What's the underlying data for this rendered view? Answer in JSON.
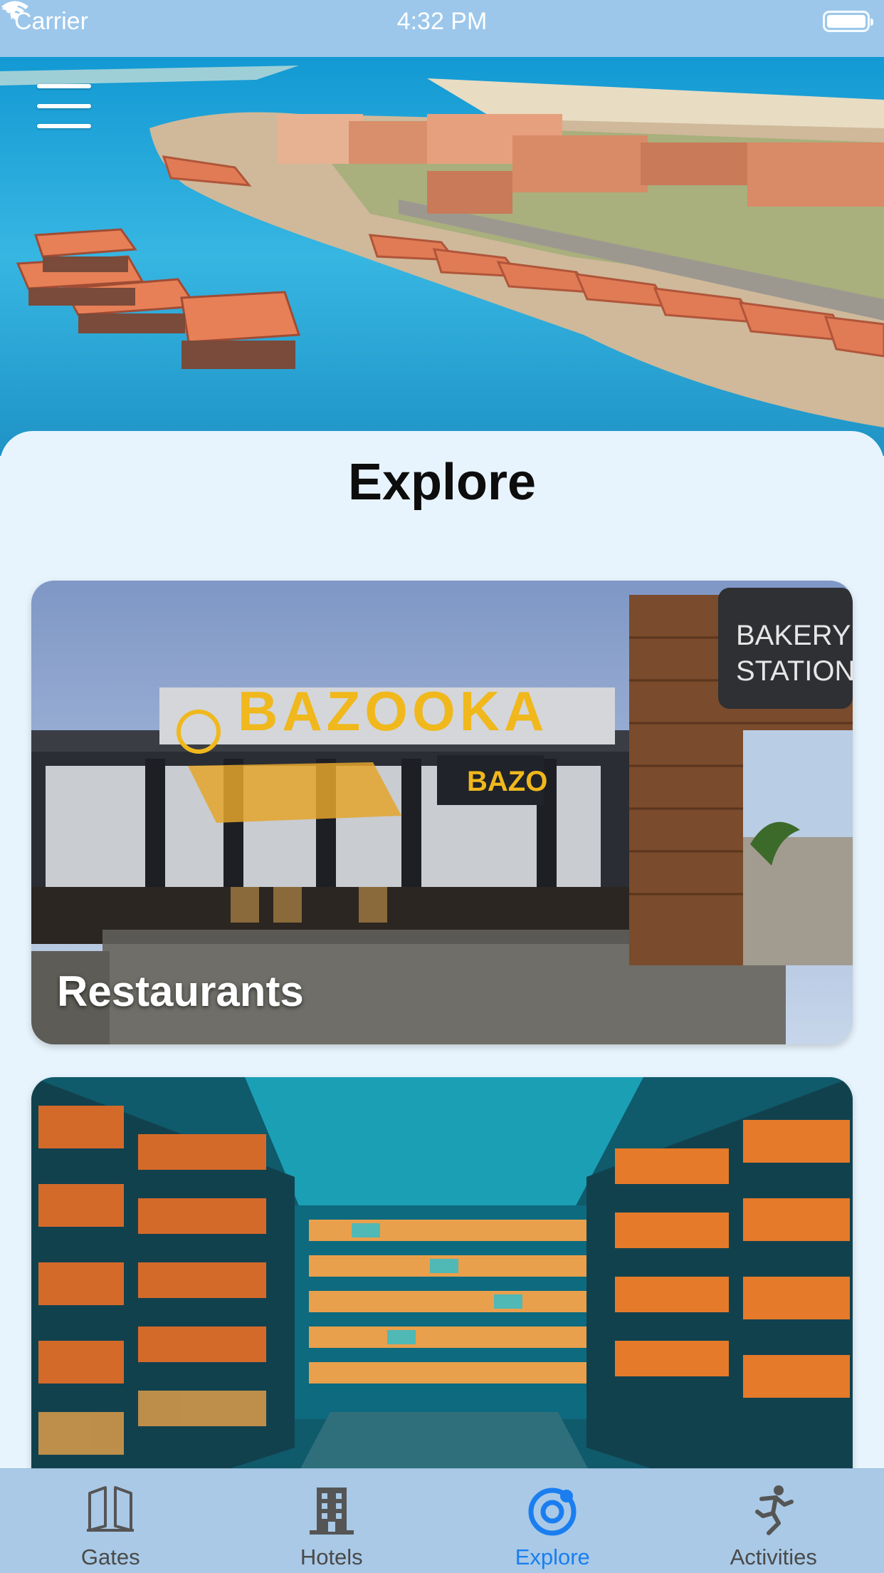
{
  "status_bar": {
    "carrier": "Carrier",
    "time": "4:32 PM"
  },
  "header": {
    "title": "Explore"
  },
  "cards": [
    {
      "label": "Restaurants"
    },
    {
      "label": ""
    }
  ],
  "tab_bar": {
    "active": "Explore",
    "accent_color": "#1a7ef0",
    "tabs": [
      {
        "label": "Gates",
        "icon": "gates-icon"
      },
      {
        "label": "Hotels",
        "icon": "hotels-icon"
      },
      {
        "label": "Explore",
        "icon": "explore-icon"
      },
      {
        "label": "Activities",
        "icon": "activities-icon"
      }
    ]
  },
  "photo_text": {
    "sign_brand": "BAZOOKA",
    "sign_small": "BAZO",
    "bakery_line1": "BAKERY",
    "bakery_line2": "STATION"
  }
}
